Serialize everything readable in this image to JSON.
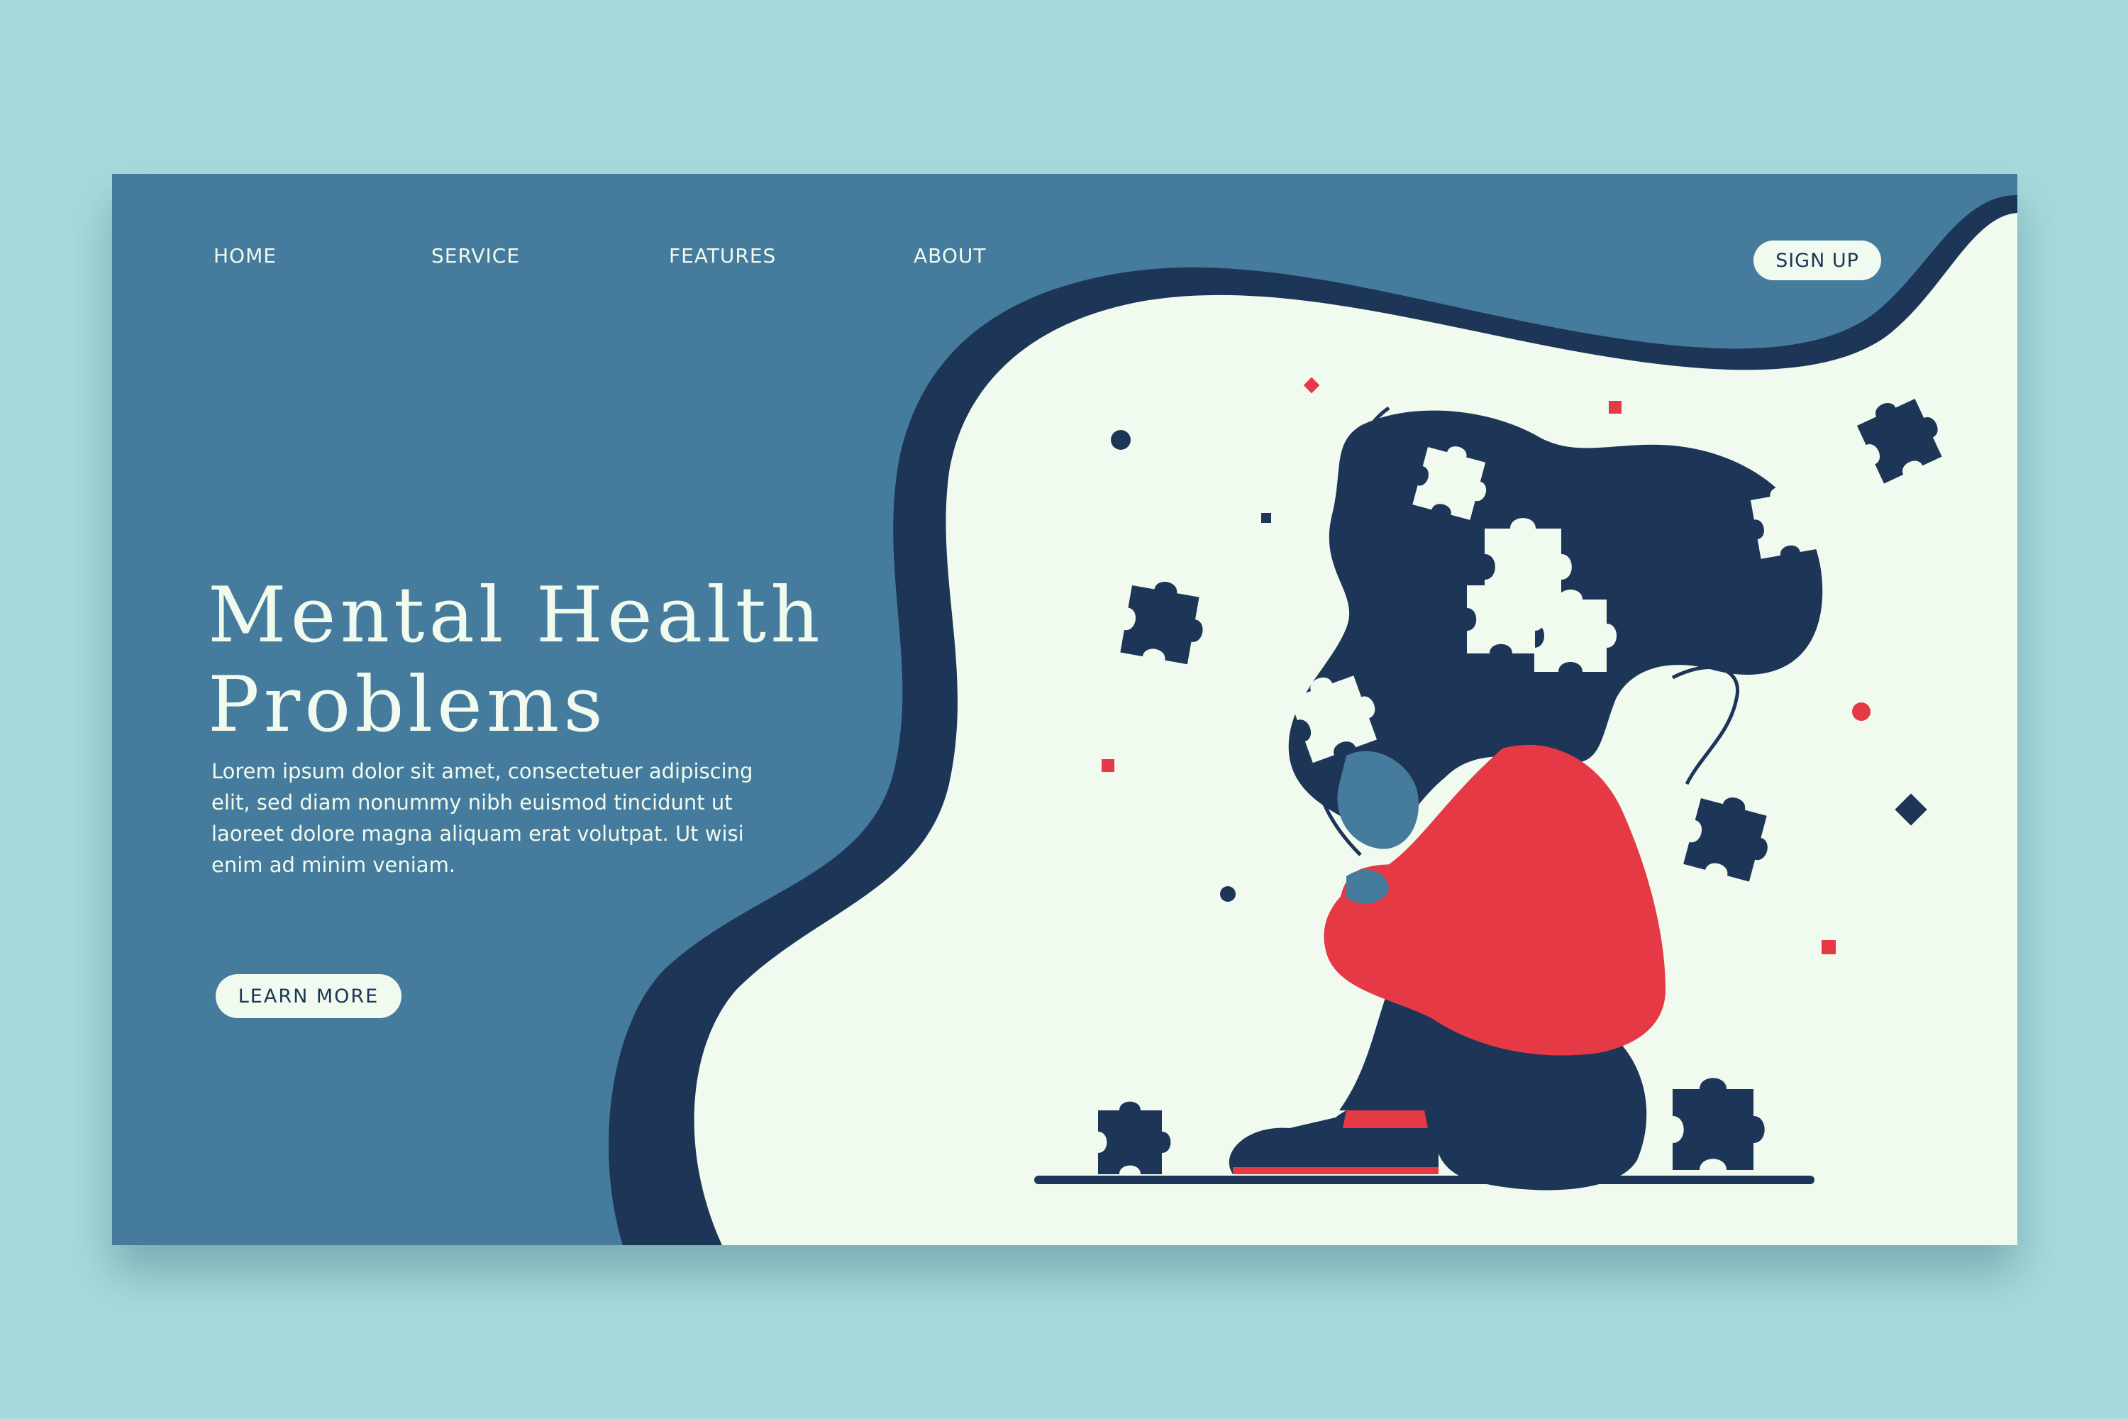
{
  "nav": {
    "items": [
      {
        "label": "HOME"
      },
      {
        "label": "SERVICE"
      },
      {
        "label": "FEATURES"
      },
      {
        "label": "ABOUT"
      }
    ],
    "signup_label": "SIGN UP"
  },
  "hero": {
    "title_line1": "Mental Health",
    "title_line2": "Problems",
    "description": "Lorem ipsum dolor sit amet, consectetuer adipiscing elit, sed diam nonummy nibh euismod tincidunt ut laoreet dolore magna aliquam erat volutpat. Ut wisi enim ad minim veniam.",
    "cta_label": "LEARN MORE"
  },
  "colors": {
    "page_background": "#a7dadc",
    "card_blue": "#457b9d",
    "navy": "#1d3557",
    "cream": "#f1faee",
    "red": "#e63946"
  },
  "illustration": {
    "subject": "person-hugging-knees-icon",
    "decorations": "puzzle-piece-icon"
  }
}
